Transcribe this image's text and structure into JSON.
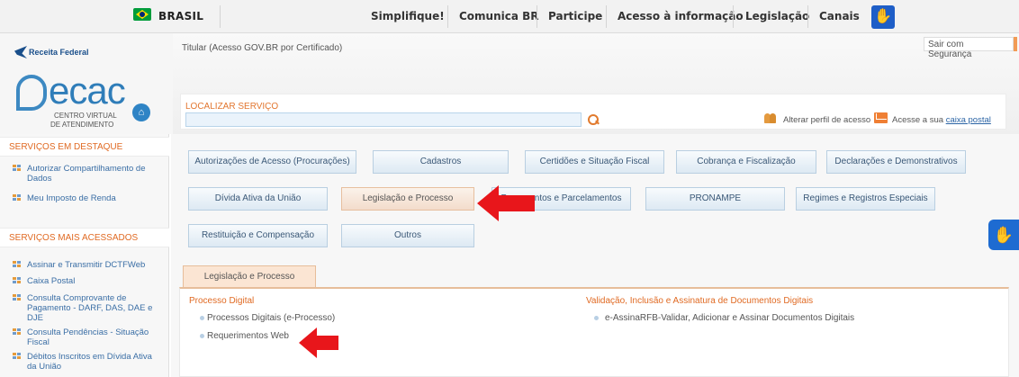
{
  "govbar": {
    "country": "BRASIL",
    "links": [
      "Simplifique!",
      "Comunica BR",
      "Participe",
      "Acesso à informação",
      "Legislação",
      "Canais"
    ],
    "accessibility_icon": "hand-sign-icon"
  },
  "brand": {
    "agency": "Receita Federal",
    "app": "ecac",
    "subtitle_line1": "CENTRO VIRTUAL",
    "subtitle_line2": "DE ATENDIMENTO",
    "home_icon": "home-icon"
  },
  "header": {
    "user": "Titular (Acesso GOV.BR por Certificado)",
    "logout": "Sair com Segurança",
    "search_label": "LOCALIZAR SERVIÇO",
    "search_placeholder": "",
    "change_profile": "Alterar perfil de acesso",
    "mailbox_prefix": "Acesse a sua",
    "mailbox_link": "caixa postal"
  },
  "sidebar": {
    "highlight_title": "SERVIÇOS EM DESTAQUE",
    "highlight_items": [
      "Autorizar Compartilhamento de Dados",
      "Meu Imposto de Renda"
    ],
    "popular_title": "SERVIÇOS MAIS ACESSADOS",
    "popular_items": [
      "Assinar e Transmitir DCTFWeb",
      "Caixa Postal",
      "Consulta Comprovante de Pagamento - DARF, DAS, DAE e DJE",
      "Consulta Pendências - Situação Fiscal",
      "Débitos Inscritos em Dívida Ativa da União"
    ]
  },
  "categories": {
    "row1": [
      "Autorizações de Acesso (Procurações)",
      "Cadastros",
      "Certidões e Situação Fiscal",
      "Cobrança e Fiscalização",
      "Declarações e Demonstrativos"
    ],
    "row2": [
      "Dívida Ativa da União",
      "Legislação e Processo",
      "Pagamentos e Parcelamentos",
      "PRONAMPE",
      "Regimes e Registros Especiais"
    ],
    "row3": [
      "Restituição e Compensação",
      "Outros"
    ],
    "active": "Legislação e Processo"
  },
  "tab": {
    "label": "Legislação e Processo",
    "groups": [
      {
        "title": "Processo Digital",
        "links": [
          "Processos Digitais (e-Processo)",
          "Requerimentos Web"
        ]
      },
      {
        "title": "Validação, Inclusão e Assinatura de Documentos Digitais",
        "links": [
          "e-AssinaRFB-Validar, Adicionar e Assinar Documentos Digitais"
        ]
      }
    ]
  },
  "colors": {
    "accent": "#e06a23",
    "link": "#3a6ea5",
    "button_border": "#b9cfe1",
    "arrow": "#e8161b"
  }
}
